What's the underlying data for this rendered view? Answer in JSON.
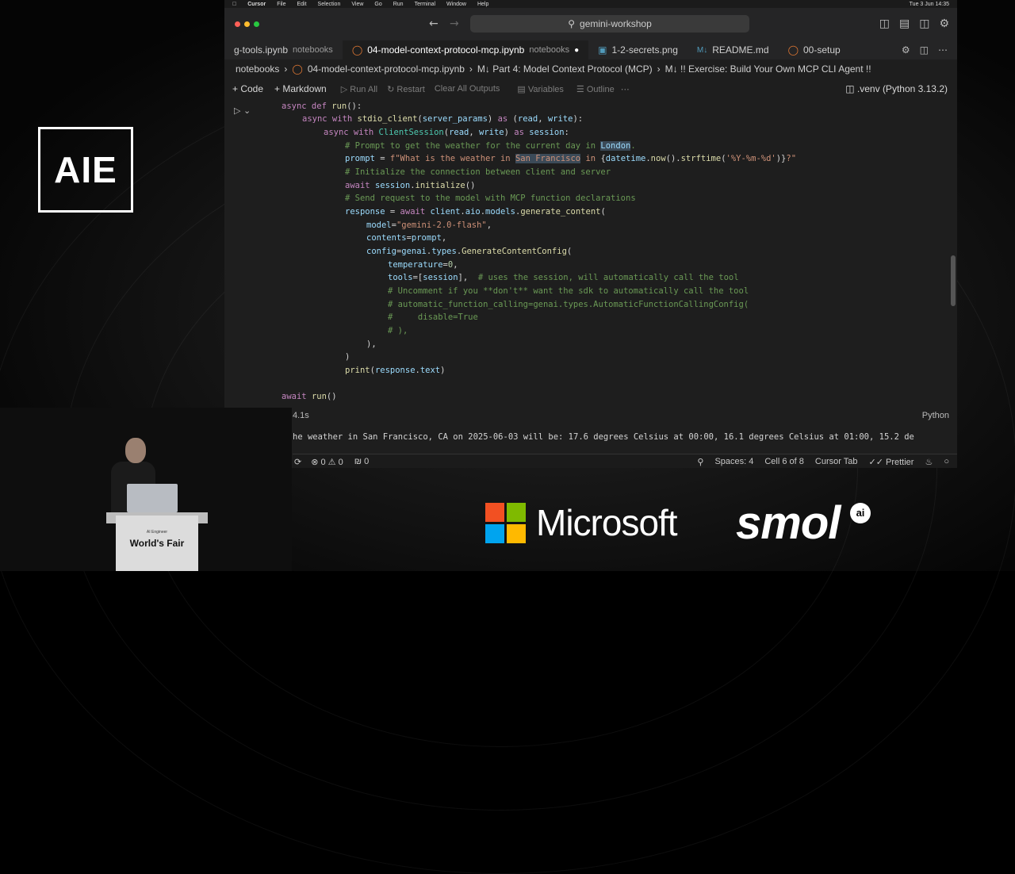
{
  "branding": {
    "logo": "AIE",
    "podium_title": "World's Fair",
    "podium_subtitle": "AI Engineer",
    "sponsor_microsoft": "Microsoft",
    "sponsor_smol": "smol",
    "sponsor_smol_badge": "ai"
  },
  "menubar": {
    "app": "Cursor",
    "items": [
      "File",
      "Edit",
      "Selection",
      "View",
      "Go",
      "Run",
      "Terminal",
      "Window",
      "Help"
    ],
    "clock": "Tue 3 Jun 14:35"
  },
  "titlebar": {
    "search": "gemini-workshop"
  },
  "tabs": [
    {
      "label": "g-tools.ipynb",
      "sub": "notebooks",
      "icon": "notebook-icon"
    },
    {
      "label": "04-model-context-protocol-mcp.ipynb",
      "sub": "notebooks",
      "icon": "notebook-icon",
      "modified": true
    },
    {
      "label": "1-2-secrets.png",
      "sub": "",
      "icon": "image-icon"
    },
    {
      "label": "README.md",
      "sub": "",
      "icon": "markdown-icon"
    },
    {
      "label": "00-setup",
      "sub": "",
      "icon": "notebook-icon"
    }
  ],
  "breadcrumbs": [
    "notebooks",
    "04-model-context-protocol-mcp.ipynb",
    "M↓ Part 4: Model Context Protocol (MCP)",
    "M↓ !! Exercise: Build Your Own MCP CLI Agent !!"
  ],
  "toolbar": {
    "code": "Code",
    "markdown": "Markdown",
    "run_all": "Run All",
    "restart": "Restart",
    "clear": "Clear All Outputs",
    "variables": "Variables",
    "outline": "Outline",
    "kernel": ".venv (Python 3.13.2)"
  },
  "cell": {
    "exec_time": "4.1s",
    "language": "Python"
  },
  "output": {
    "text": "he weather in San Francisco, CA on 2025-06-03 will be: 17.6 degrees Celsius at 00:00, 16.1 degrees Celsius at 01:00, 15.2 de"
  },
  "statusbar": {
    "errors": "0",
    "warnings": "0",
    "ports": "0",
    "spaces": "Spaces: 4",
    "cell": "Cell 6 of 8",
    "tab": "Cursor Tab",
    "prettier": "Prettier"
  }
}
